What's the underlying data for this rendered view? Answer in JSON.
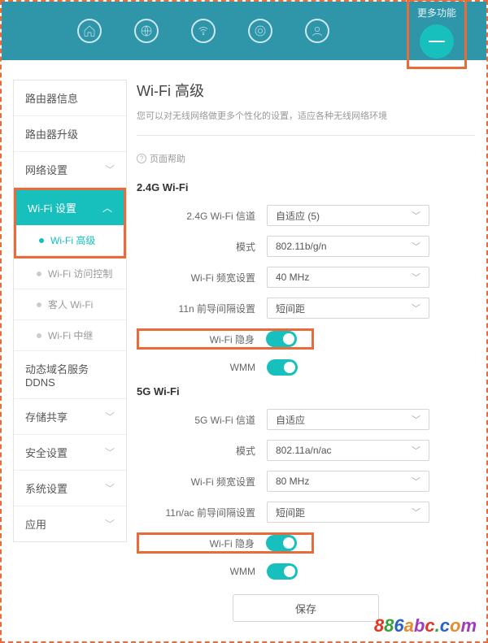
{
  "topnav": {
    "more_label": "更多功能"
  },
  "sidebar": {
    "router_info": "路由器信息",
    "router_upgrade": "路由器升级",
    "network": "网络设置",
    "wifi": "Wi-Fi 设置",
    "wifi_sub": {
      "advanced": "Wi-Fi 高级",
      "access_ctrl": "Wi-Fi 访问控制",
      "guest": "客人 Wi-Fi",
      "repeat": "Wi-Fi 中继"
    },
    "ddns": "动态域名服务 DDNS",
    "storage": "存储共享",
    "security": "安全设置",
    "system": "系统设置",
    "app": "应用"
  },
  "main": {
    "title": "Wi-Fi 高级",
    "desc": "您可以对无线网络做更多个性化的设置，适应各种无线网络环境",
    "help": "页面帮助"
  },
  "w24": {
    "title": "2.4G Wi-Fi",
    "channel_label": "2.4G Wi-Fi 信道",
    "channel_value": "自适应 (5)",
    "mode_label": "模式",
    "mode_value": "802.11b/g/n",
    "bw_label": "Wi-Fi 频宽设置",
    "bw_value": "40 MHz",
    "preamble_label": "11n 前导间隔设置",
    "preamble_value": "短间距",
    "wifi_toggle_label": "Wi-Fi 隐身",
    "wmm_label": "WMM"
  },
  "w5": {
    "title": "5G Wi-Fi",
    "channel_label": "5G Wi-Fi 信道",
    "channel_value": "自适应",
    "mode_label": "模式",
    "mode_value": "802.11a/n/ac",
    "bw_label": "Wi-Fi 频宽设置",
    "bw_value": "80 MHz",
    "preamble_label": "11n/ac 前导间隔设置",
    "preamble_value": "短间距",
    "wifi_toggle_label": "Wi-Fi 隐身",
    "wmm_label": "WMM"
  },
  "save_label": "保存",
  "watermark": "886abc.com"
}
